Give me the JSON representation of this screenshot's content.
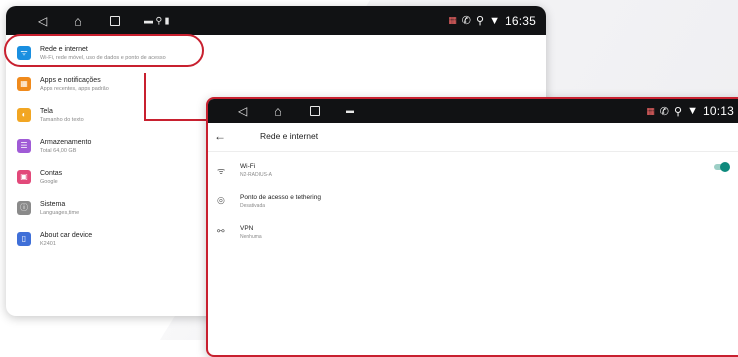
{
  "device_back": {
    "time": "16:35",
    "settings": [
      {
        "title": "Rede e internet",
        "subtitle": "Wi-Fi, rede móvel, uso de dados e ponto de acesso",
        "color": "#1a8fe0",
        "icon": "wifi-icon"
      },
      {
        "title": "Apps e notificações",
        "subtitle": "Apps recentes, apps padrão",
        "color": "#f08a1c",
        "icon": "apps-icon"
      },
      {
        "title": "Tela",
        "subtitle": "Tamanho do texto",
        "color": "#f2a623",
        "icon": "display-icon"
      },
      {
        "title": "Armazenamento",
        "subtitle": "Total 64,00 GB",
        "color": "#a05bd6",
        "icon": "storage-icon"
      },
      {
        "title": "Contas",
        "subtitle": "Google",
        "color": "#e2497a",
        "icon": "accounts-icon"
      },
      {
        "title": "Sistema",
        "subtitle": "Languages,time",
        "color": "#8a8a8a",
        "icon": "system-info-icon"
      },
      {
        "title": "About car device",
        "subtitle": "K2401",
        "color": "#3f6fd8",
        "icon": "phone-icon"
      }
    ]
  },
  "device_front": {
    "time": "10:13",
    "page_title": "Rede e internet",
    "rows": [
      {
        "title": "Wi-Fi",
        "subtitle": "N2-RADIUS-A",
        "icon": "wifi-icon",
        "glyph": "ᯤ",
        "toggle": true
      },
      {
        "title": "Ponto de acesso e tethering",
        "subtitle": "Desativada",
        "icon": "hotspot-icon",
        "glyph": "◎",
        "toggle": false
      },
      {
        "title": "VPN",
        "subtitle": "Nenhuma",
        "icon": "vpn-icon",
        "glyph": "⚯",
        "toggle": false
      }
    ]
  },
  "colors": {
    "accent": "#c8202f",
    "toggle": "#0e8a7d"
  }
}
